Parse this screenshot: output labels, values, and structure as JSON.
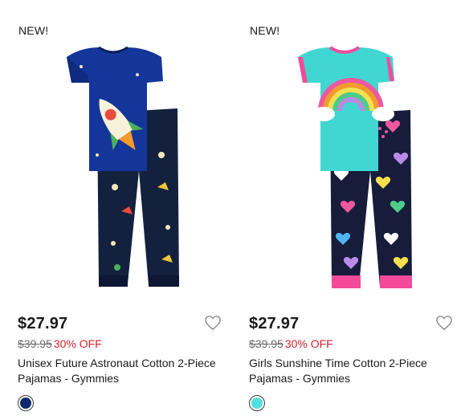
{
  "products": [
    {
      "badge": "NEW!",
      "sale_price": "$27.97",
      "original_price": "$39.95",
      "discount": "30% OFF",
      "title": "Unisex Future Astronaut Cotton 2-Piece Pajamas - Gymmies",
      "swatch_color": "#0e2a6e",
      "favorite_icon": "heart-outline-icon",
      "shirt_color": "#14359a",
      "pants_color": "#13213f"
    },
    {
      "badge": "NEW!",
      "sale_price": "$27.97",
      "original_price": "$39.95",
      "discount": "30% OFF",
      "title": "Girls Sunshine Time Cotton 2-Piece Pajamas - Gymmies",
      "swatch_color": "#4fe1df",
      "favorite_icon": "heart-outline-icon",
      "shirt_color": "#41d6d2",
      "pants_color": "#161c3a"
    }
  ],
  "colors": {
    "discount": "#d3202a",
    "text": "#1a1a1a",
    "strikethrough": "#6b6b6b"
  }
}
